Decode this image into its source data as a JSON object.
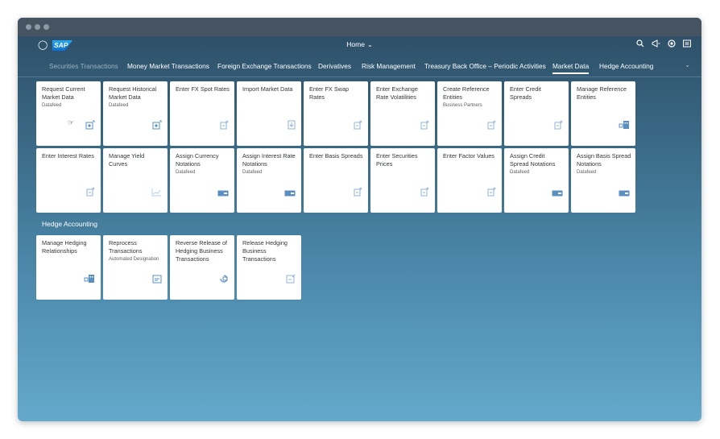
{
  "window": {
    "dots": [
      "window-dot",
      "window-dot",
      "window-dot"
    ]
  },
  "shell": {
    "user_icon": "user-icon",
    "logo_text": "SAP",
    "home_label": "Home",
    "home_chevron": "⌄",
    "icons": {
      "search": "search-icon",
      "notifications": "megaphone-icon",
      "copilot": "copilot-icon",
      "menu": "menu-icon"
    }
  },
  "tabs": [
    "Securities Transactions",
    "Money Market Transactions",
    "Foreign Exchange Transactions",
    "Derivatives",
    "Risk Management",
    "Treasury Back Office – Periodic Activities",
    "Market Data",
    "Hedge Accounting"
  ],
  "tabs_active": "Market Data",
  "tabs_overflow": "⌄",
  "market_data_tiles": [
    {
      "title": "Request Current Market Data",
      "subtitle": "Datafeed",
      "icon": "download-file-icon"
    },
    {
      "title": "Request Historical Market Data",
      "subtitle": "Datafeed",
      "icon": "download-file-icon"
    },
    {
      "title": "Enter FX Spot Rates",
      "subtitle": "",
      "icon": "add-document-icon"
    },
    {
      "title": "Import Market Data",
      "subtitle": "",
      "icon": "import-document-icon"
    },
    {
      "title": "Enter FX Swap Rates",
      "subtitle": "",
      "icon": "add-document-icon"
    },
    {
      "title": "Enter Exchange Rate Volatilities",
      "subtitle": "",
      "icon": "add-document-icon"
    },
    {
      "title": "Create Reference Entities",
      "subtitle": "Business Partners",
      "icon": "add-document-icon"
    },
    {
      "title": "Enter Credit Spreads",
      "subtitle": "",
      "icon": "add-document-icon"
    },
    {
      "title": "Manage Reference Entities",
      "subtitle": "",
      "icon": "building-link-icon"
    },
    {
      "title": "Enter Interest Rates",
      "subtitle": "",
      "icon": "add-document-icon"
    },
    {
      "title": "Manage Yield Curves",
      "subtitle": "",
      "icon": "line-chart-icon"
    },
    {
      "title": "Assign Currency Notations",
      "subtitle": "Datafeed",
      "icon": "card-icon"
    },
    {
      "title": "Assign Interest Rate Notations",
      "subtitle": "Datafeed",
      "icon": "card-icon"
    },
    {
      "title": "Enter Basis Spreads",
      "subtitle": "",
      "icon": "add-document-icon"
    },
    {
      "title": "Enter Securities Prices",
      "subtitle": "",
      "icon": "add-document-icon"
    },
    {
      "title": "Enter Factor Values",
      "subtitle": "",
      "icon": "add-document-icon"
    },
    {
      "title": "Assign Credit Spread Notations",
      "subtitle": "Datafeed",
      "icon": "card-icon"
    },
    {
      "title": "Assign Basis Spread Notations",
      "subtitle": "Datafeed",
      "icon": "card-icon"
    }
  ],
  "hedge_group_title": "Hedge Accounting",
  "hedge_tiles": [
    {
      "title": "Manage Hedging Relationships",
      "subtitle": "",
      "icon": "building-link-icon"
    },
    {
      "title": "Reprocess Transactions",
      "subtitle": "Automated Designation",
      "icon": "calendar-icon"
    },
    {
      "title": "Reverse Release of Hedging Business Transactions",
      "subtitle": "",
      "icon": "undo-icon"
    },
    {
      "title": "Release Hedging Business Transactions",
      "subtitle": "",
      "icon": "document-edit-icon"
    }
  ],
  "colors": {
    "accent": "#0a6ed1",
    "tile_icon": "#5a8fc1",
    "text": "#32363a"
  }
}
